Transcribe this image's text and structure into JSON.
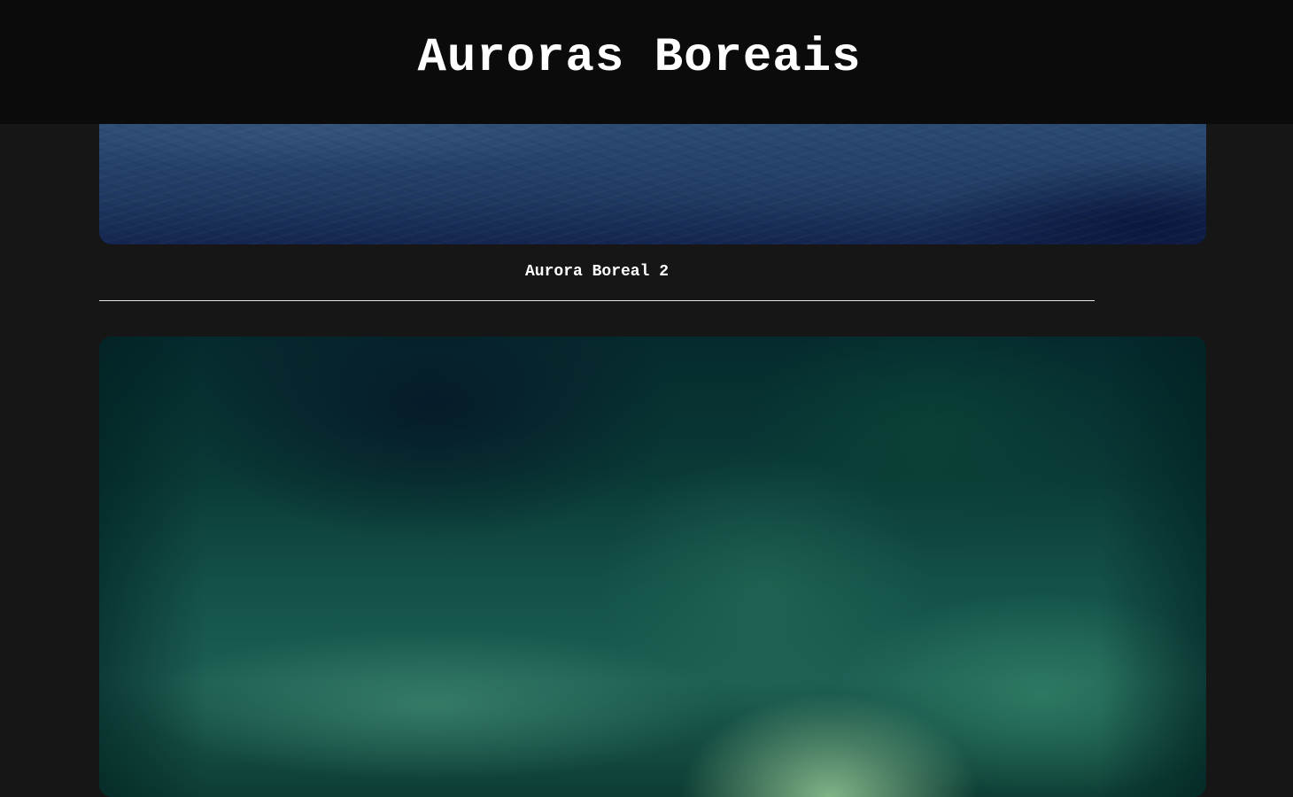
{
  "header": {
    "title": "Auroras Boreais"
  },
  "gallery": {
    "items": [
      {
        "caption": ""
      },
      {
        "caption": "Aurora Boreal 2"
      },
      {
        "caption": ""
      }
    ]
  },
  "colors": {
    "page_background": "#161616",
    "header_background": "#0b0b0b",
    "text": "#ffffff"
  }
}
